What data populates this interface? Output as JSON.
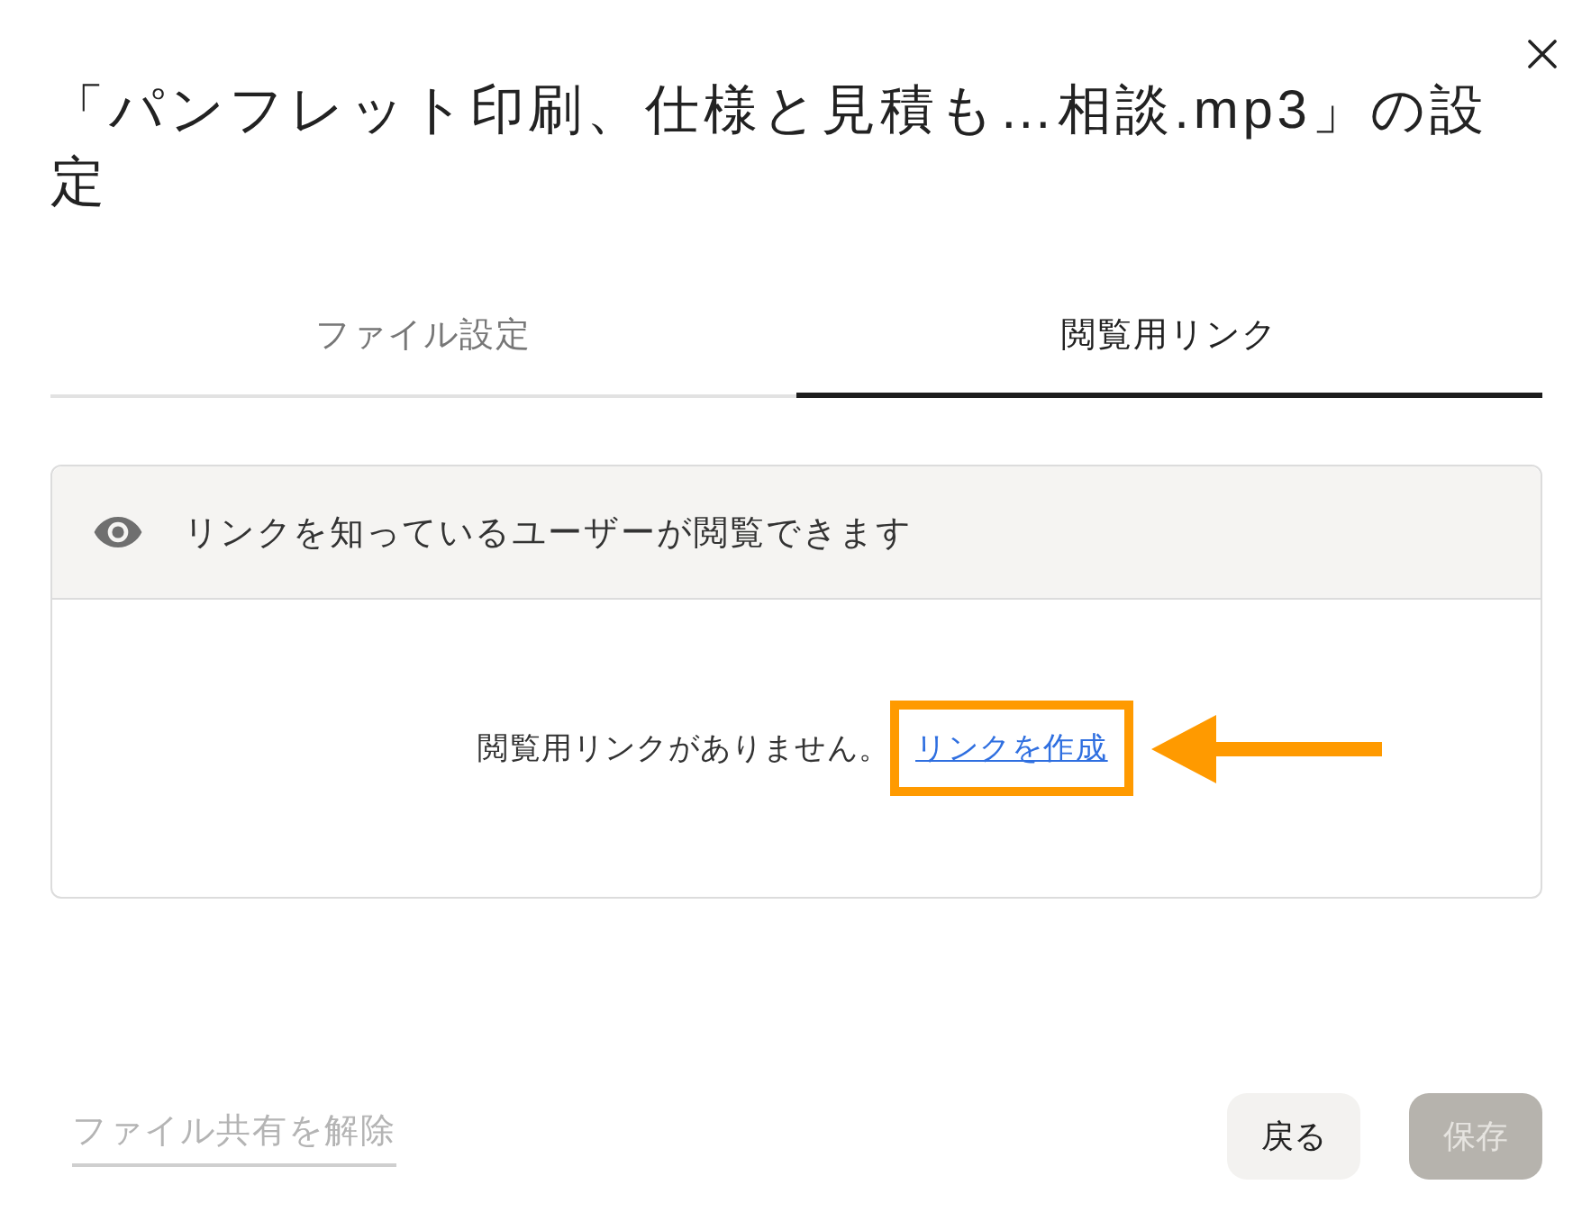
{
  "dialog": {
    "title": "「パンフレット印刷、仕様と見積も…相談.mp3」の設定"
  },
  "tabs": [
    {
      "label": "ファイル設定",
      "selected": false
    },
    {
      "label": "閲覧用リンク",
      "selected": true
    }
  ],
  "link_panel": {
    "header": "リンクを知っているユーザーが閲覧できます",
    "message": "閲覧用リンクがありません。",
    "create_link": "リンクを作成"
  },
  "footer": {
    "unshare": {
      "label": "ファイル共有を解除",
      "disabled": true
    },
    "buttons": [
      {
        "label": "戻る",
        "kind": "secondary",
        "disabled": false
      },
      {
        "label": "保存",
        "kind": "primary",
        "disabled": true
      }
    ]
  }
}
